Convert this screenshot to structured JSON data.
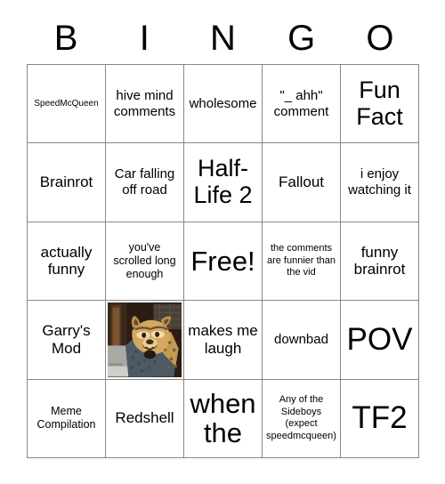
{
  "card": {
    "title": "BINGO",
    "header_letters": [
      "B",
      "I",
      "N",
      "G",
      "O"
    ],
    "grid_size": "5x5",
    "free_space": "Free!",
    "colors": {
      "background": "#ffffff",
      "grid_line": "#888888",
      "text": "#000000",
      "image_backdrop": "#2b1d12"
    }
  },
  "cells": [
    {
      "r": 1,
      "c": 1,
      "text": "SpeedMcQueen",
      "size": "xs",
      "type": "text"
    },
    {
      "r": 1,
      "c": 2,
      "text": "hive mind comments",
      "size": "m",
      "type": "text"
    },
    {
      "r": 1,
      "c": 3,
      "text": "wholesome",
      "size": "m",
      "type": "text"
    },
    {
      "r": 1,
      "c": 4,
      "text": "\"_ ahh\" comment",
      "size": "m",
      "type": "text"
    },
    {
      "r": 1,
      "c": 5,
      "text": "Fun Fact",
      "size": "xl",
      "type": "text"
    },
    {
      "r": 2,
      "c": 1,
      "text": "Brainrot",
      "size": "ml",
      "type": "text"
    },
    {
      "r": 2,
      "c": 2,
      "text": "Car falling off road",
      "size": "m",
      "type": "text"
    },
    {
      "r": 2,
      "c": 3,
      "text": "Half-Life 2",
      "size": "xl",
      "type": "text"
    },
    {
      "r": 2,
      "c": 4,
      "text": "Fallout",
      "size": "ml",
      "type": "text"
    },
    {
      "r": 2,
      "c": 5,
      "text": "i enjoy watching it",
      "size": "m",
      "type": "text"
    },
    {
      "r": 3,
      "c": 1,
      "text": "actually funny",
      "size": "ml",
      "type": "text"
    },
    {
      "r": 3,
      "c": 2,
      "text": "you've scrolled long enough",
      "size": "sm",
      "type": "text"
    },
    {
      "r": 3,
      "c": 3,
      "text": "Free!",
      "size": "xxl",
      "type": "free"
    },
    {
      "r": 3,
      "c": 4,
      "text": "the comments are funnier than the vid",
      "size": "s",
      "type": "text"
    },
    {
      "r": 3,
      "c": 5,
      "text": "funny brainrot",
      "size": "ml",
      "type": "text"
    },
    {
      "r": 4,
      "c": 1,
      "text": "Garry's Mod",
      "size": "ml",
      "type": "text"
    },
    {
      "r": 4,
      "c": 2,
      "text": "",
      "size": "m",
      "type": "image",
      "image_name": "snow-leopard-meme-image"
    },
    {
      "r": 4,
      "c": 3,
      "text": "makes me laugh",
      "size": "ml",
      "type": "text"
    },
    {
      "r": 4,
      "c": 4,
      "text": "downbad",
      "size": "m",
      "type": "text"
    },
    {
      "r": 4,
      "c": 5,
      "text": "POV",
      "size": "huge",
      "type": "text"
    },
    {
      "r": 5,
      "c": 1,
      "text": "Meme Compilation",
      "size": "sm",
      "type": "text"
    },
    {
      "r": 5,
      "c": 2,
      "text": "Redshell",
      "size": "ml",
      "type": "text"
    },
    {
      "r": 5,
      "c": 3,
      "text": "when the",
      "size": "xxl",
      "type": "text"
    },
    {
      "r": 5,
      "c": 4,
      "text": "Any of the Sideboys (expect speedmcqueen)",
      "size": "s",
      "type": "text"
    },
    {
      "r": 5,
      "c": 5,
      "text": "TF2",
      "size": "huge",
      "type": "text"
    }
  ]
}
